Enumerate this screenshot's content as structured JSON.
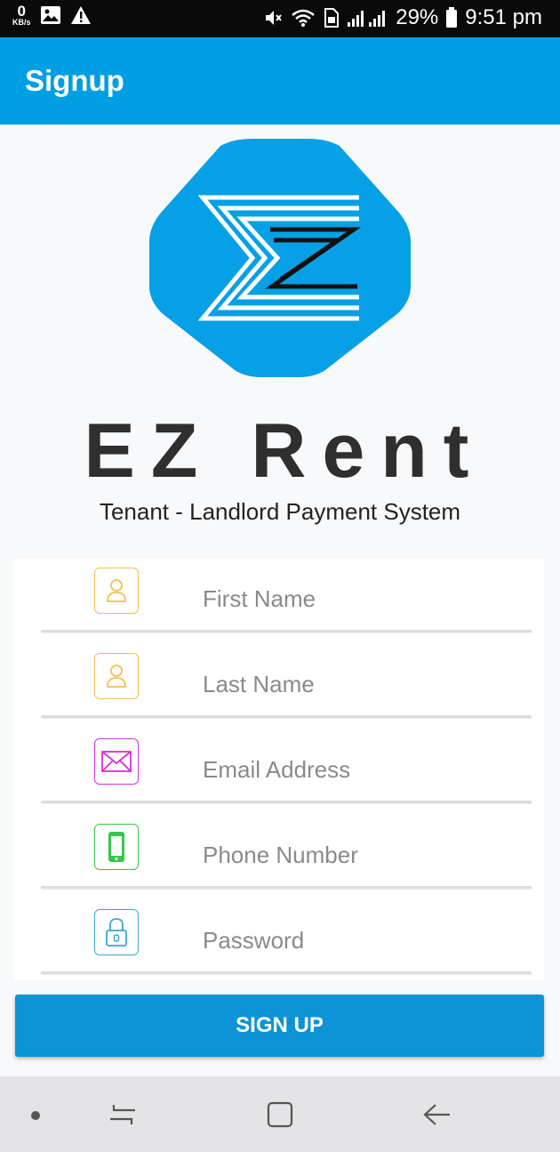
{
  "status_bar": {
    "speed_value": "0",
    "speed_unit": "KB/s",
    "battery": "29%",
    "time": "9:51 pm"
  },
  "app_bar": {
    "title": "Signup"
  },
  "logo": {
    "brand": "EZ Rent",
    "tagline": "Tenant - Landlord Payment System"
  },
  "form": {
    "fields": [
      {
        "placeholder": "First Name",
        "icon": "person-icon",
        "color": "#f2c14e"
      },
      {
        "placeholder": "Last Name",
        "icon": "person-icon",
        "color": "#f2c14e"
      },
      {
        "placeholder": "Email Address",
        "icon": "envelope-icon",
        "color": "#d630d6"
      },
      {
        "placeholder": "Phone Number",
        "icon": "phone-icon",
        "color": "#35c84a"
      },
      {
        "placeholder": "Password",
        "icon": "lock-icon",
        "color": "#3aa9c8"
      }
    ]
  },
  "signup_button": {
    "label": "SIGN UP"
  },
  "colors": {
    "primary": "#009ee3",
    "button": "#0b94d6",
    "status_bar": "#0a0a0a"
  }
}
